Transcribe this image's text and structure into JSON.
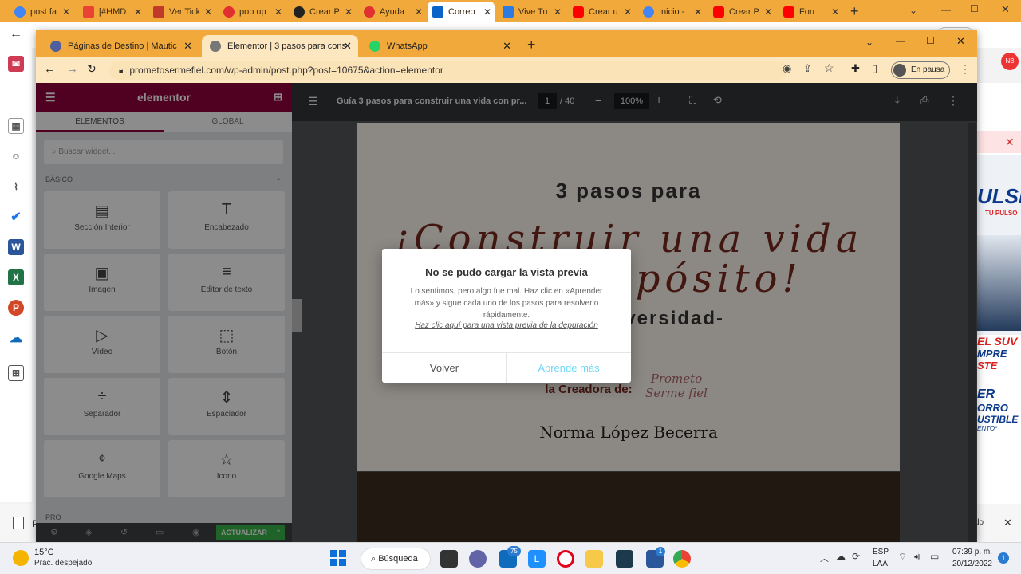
{
  "outer_browser": {
    "tabs": [
      {
        "label": "post fa",
        "color": "#4285f4"
      },
      {
        "label": "[#HMD",
        "color": "#ea4335"
      },
      {
        "label": "Ver Tick",
        "color": "#c0392b"
      },
      {
        "label": "pop up",
        "color": "#e03030"
      },
      {
        "label": "Crear P",
        "color": "#222222"
      },
      {
        "label": "Ayuda",
        "color": "#e03030"
      },
      {
        "label": "Correo",
        "color": "#0a64c8"
      },
      {
        "label": "Vive Tu",
        "color": "#2d7be0"
      },
      {
        "label": "Crear u",
        "color": "#ff0000"
      },
      {
        "label": "Inicio -",
        "color": "#4285f4"
      },
      {
        "label": "Crear P",
        "color": "#ff0000"
      },
      {
        "label": "Forr",
        "color": "#ff0000"
      }
    ],
    "profile": "Pausa"
  },
  "left_rail": {
    "icons": [
      "mail-icon",
      "calendar-icon",
      "people-icon",
      "attach-icon",
      "todo-icon",
      "word-icon",
      "excel-icon",
      "powerpoint-icon",
      "onedrive-icon",
      "apps-icon"
    ]
  },
  "inner_browser": {
    "tabs": [
      {
        "label": "Páginas de Destino | Mautic"
      },
      {
        "label": "Elementor | 3 pasos para constru"
      },
      {
        "label": "WhatsApp"
      }
    ],
    "url": "prometosermefiel.com/wp-admin/post.php?post=10675&action=elementor",
    "profile_label": "En pausa",
    "avatar_initials": "NB"
  },
  "elementor": {
    "logo": "elementor",
    "tabs": [
      "ELEMENTOS",
      "GLOBAL"
    ],
    "search_placeholder": "Buscar widget...",
    "section": "BÁSICO",
    "widgets": [
      "Sección Interior",
      "Encabezado",
      "Imagen",
      "Editor de texto",
      "Vídeo",
      "Botón",
      "Separador",
      "Espaciador",
      "Google Maps",
      "Icono"
    ],
    "pro_label": "PRO",
    "update_button": "ACTUALIZAR"
  },
  "pdf_viewer": {
    "title": "Guía 3 pasos para construir una vida con pr...",
    "page": "1",
    "page_total": "/ 40",
    "zoom": "100%",
    "doc": {
      "line1": "3 pasos para",
      "line2": "¡Construir una vida",
      "line3": "con propósito!",
      "line4": "-en la adversidad-",
      "creator_label": "la  Creadora de:",
      "signature": "Prometo Serme fiel",
      "author": "Norma  López Becerra"
    }
  },
  "dialog": {
    "title": "No se pudo cargar la vista previa",
    "body": "Lo sentimos, pero algo fue mal. Haz clic en «Aprender más» y sigue cada uno de los pasos para resolverlo rápidamente.",
    "debug_link": "Haz clic aquí para una vista previa de la depuración",
    "back_button": "Volver",
    "learn_button": "Aprende más"
  },
  "ad": {
    "lines": [
      "ULSE",
      "TU PULSO",
      "EL SUV",
      "MPRE",
      "STE",
      "ER",
      "ORRO",
      "USTIBLE",
      "ENTO*"
    ]
  },
  "notification": {
    "left": "P",
    "right": "do"
  },
  "taskbar": {
    "weather_temp": "15°C",
    "weather_desc": "Prac. despejado",
    "search_label": "Búsqueda",
    "badge_teams": "75",
    "badge_app": "1",
    "lang1": "ESP",
    "lang2": "LAA",
    "time": "07:39 p. m.",
    "date": "20/12/2022",
    "notif_count": "1"
  }
}
